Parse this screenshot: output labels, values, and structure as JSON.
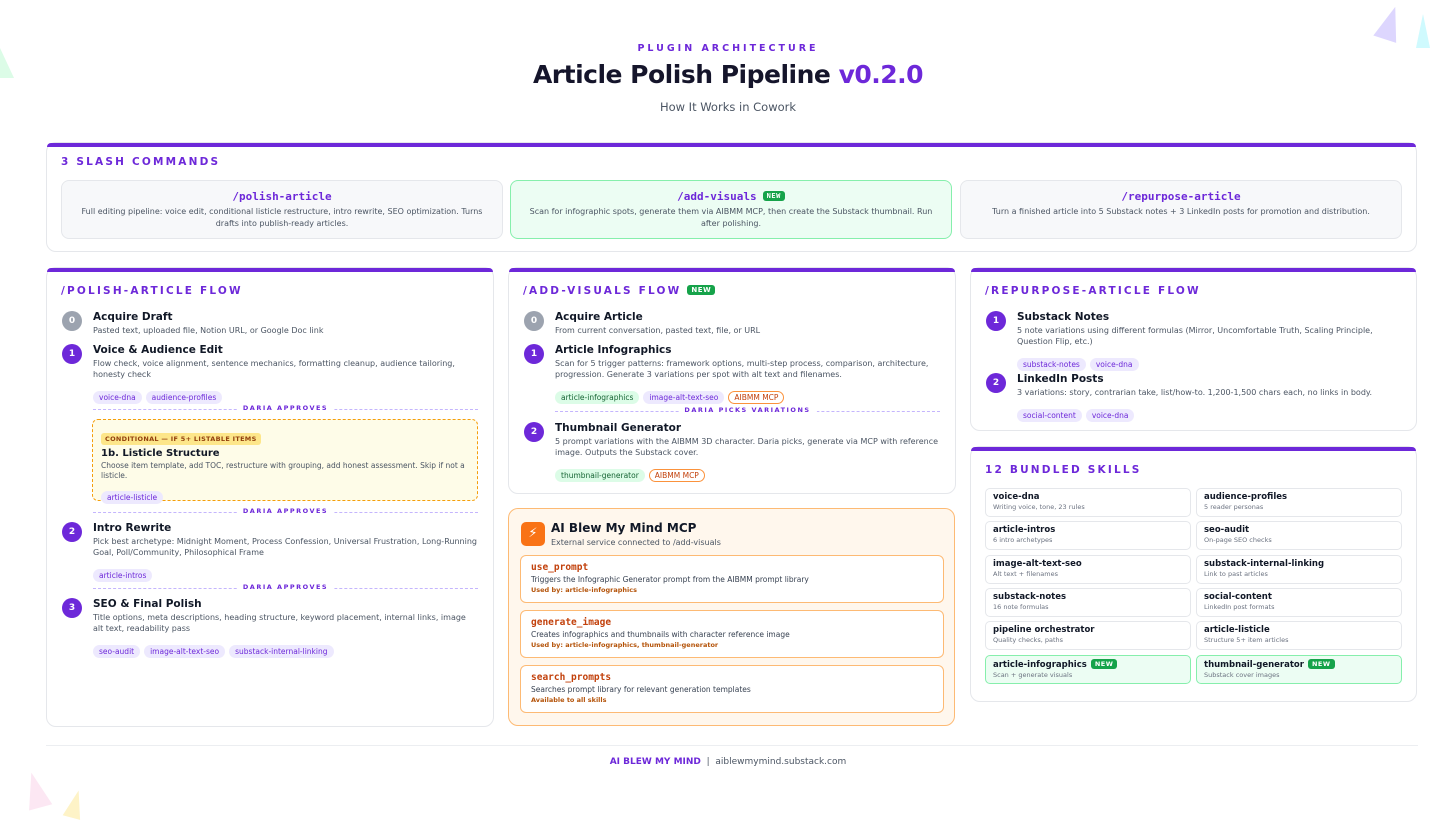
{
  "header": {
    "eyebrow": "PLUGIN ARCHITECTURE",
    "title": "Article Polish Pipeline",
    "version": "v0.2.0",
    "subtitle": "How It Works in Cowork"
  },
  "commands": {
    "title": "3 SLASH COMMANDS",
    "items": [
      {
        "name": "/polish-article",
        "desc": "Full editing pipeline: voice edit, conditional listicle restructure, intro rewrite, SEO optimization. Turns drafts into publish-ready articles."
      },
      {
        "name": "/add-visuals",
        "badge": "NEW",
        "desc": "Scan for infographic spots, generate them via AIBMM MCP, then create the Substack thumbnail. Run after polishing."
      },
      {
        "name": "/repurpose-article",
        "desc": "Turn a finished article into 5 Substack notes + 3 LinkedIn posts for promotion and distribution."
      }
    ]
  },
  "polish_flow": {
    "title": "/POLISH-ARTICLE FLOW",
    "steps": [
      {
        "num": "0",
        "title": "Acquire Draft",
        "desc": "Pasted text, uploaded file, Notion URL, or Google Doc link"
      },
      {
        "num": "1",
        "title": "Voice & Audience Edit",
        "desc": "Flow check, voice alignment, sentence mechanics, formatting cleanup, audience tailoring, honesty check",
        "tags": [
          "voice-dna",
          "audience-profiles"
        ]
      },
      {
        "num": "2",
        "title": "Intro Rewrite",
        "desc": "Pick best archetype: Midnight Moment, Process Confession, Universal Frustration, Long-Running Goal, Poll/Community, Philosophical Frame",
        "tags": [
          "article-intros"
        ]
      },
      {
        "num": "3",
        "title": "SEO & Final Polish",
        "desc": "Title options, meta descriptions, heading structure, keyword placement, internal links, image alt text, readability pass",
        "tags": [
          "seo-audit",
          "image-alt-text-seo",
          "substack-internal-linking"
        ]
      }
    ],
    "approval_label": "DARIA APPROVES",
    "conditional": {
      "badge": "CONDITIONAL — IF 5+ LISTABLE ITEMS",
      "title": "1b. Listicle Structure",
      "desc": "Choose item template, add TOC, restructure with grouping, add honest assessment. Skip if not a listicle.",
      "tags": [
        "article-listicle"
      ]
    }
  },
  "visuals_flow": {
    "title": "/ADD-VISUALS FLOW",
    "badge": "NEW",
    "steps": [
      {
        "num": "0",
        "title": "Acquire Article",
        "desc": "From current conversation, pasted text, file, or URL"
      },
      {
        "num": "1",
        "title": "Article Infographics",
        "desc": "Scan for 5 trigger patterns: framework options, multi-step process, comparison, architecture, progression. Generate 3 variations per spot with alt text and filenames.",
        "tags": [
          "article-infographics",
          "image-alt-text-seo",
          "AIBMM MCP"
        ]
      },
      {
        "num": "2",
        "title": "Thumbnail Generator",
        "desc": "5 prompt variations with the AIBMM 3D character. Daria picks, generate via MCP with reference image. Outputs the Substack cover.",
        "tags": [
          "thumbnail-generator",
          "AIBMM MCP"
        ]
      }
    ],
    "picks_label": "DARIA PICKS VARIATIONS"
  },
  "mcp": {
    "icon": "⚡",
    "title": "AI Blew My Mind MCP",
    "subtitle": "External service connected to /add-visuals",
    "tools": [
      {
        "name": "use_prompt",
        "desc": "Triggers the Infographic Generator prompt from the AIBMM prompt library",
        "used": "Used by: article-infographics"
      },
      {
        "name": "generate_image",
        "desc": "Creates infographics and thumbnails with character reference image",
        "used": "Used by: article-infographics, thumbnail-generator"
      },
      {
        "name": "search_prompts",
        "desc": "Searches prompt library for relevant generation templates",
        "used": "Available to all skills"
      }
    ]
  },
  "repurpose_flow": {
    "title": "/REPURPOSE-ARTICLE FLOW",
    "steps": [
      {
        "num": "1",
        "title": "Substack Notes",
        "desc": "5 note variations using different formulas (Mirror, Uncomfortable Truth, Scaling Principle, Question Flip, etc.)",
        "tags": [
          "substack-notes",
          "voice-dna"
        ]
      },
      {
        "num": "2",
        "title": "LinkedIn Posts",
        "desc": "3 variations: story, contrarian take, list/how-to. 1,200-1,500 chars each, no links in body.",
        "tags": [
          "social-content",
          "voice-dna"
        ]
      }
    ]
  },
  "skills": {
    "title": "12 BUNDLED SKILLS",
    "items": [
      {
        "name": "voice-dna",
        "desc": "Writing voice, tone, 23 rules"
      },
      {
        "name": "audience-profiles",
        "desc": "5 reader personas"
      },
      {
        "name": "article-intros",
        "desc": "6 intro archetypes"
      },
      {
        "name": "seo-audit",
        "desc": "On-page SEO checks"
      },
      {
        "name": "image-alt-text-seo",
        "desc": "Alt text + filenames"
      },
      {
        "name": "substack-internal-linking",
        "desc": "Link to past articles"
      },
      {
        "name": "substack-notes",
        "desc": "16 note formulas"
      },
      {
        "name": "social-content",
        "desc": "LinkedIn post formats"
      },
      {
        "name": "pipeline orchestrator",
        "desc": "Quality checks, paths"
      },
      {
        "name": "article-listicle",
        "desc": "Structure 5+ item articles"
      },
      {
        "name": "article-infographics",
        "desc": "Scan + generate visuals",
        "badge": "NEW"
      },
      {
        "name": "thumbnail-generator",
        "desc": "Substack cover images",
        "badge": "NEW"
      }
    ]
  },
  "footer": {
    "brand": "AI BLEW MY MIND",
    "sep": "|",
    "url": "aiblewmymind.substack.com"
  },
  "colors": {
    "accent": "#6d28d9",
    "new_badge": "#16a34a",
    "mcp": "#f97316"
  }
}
